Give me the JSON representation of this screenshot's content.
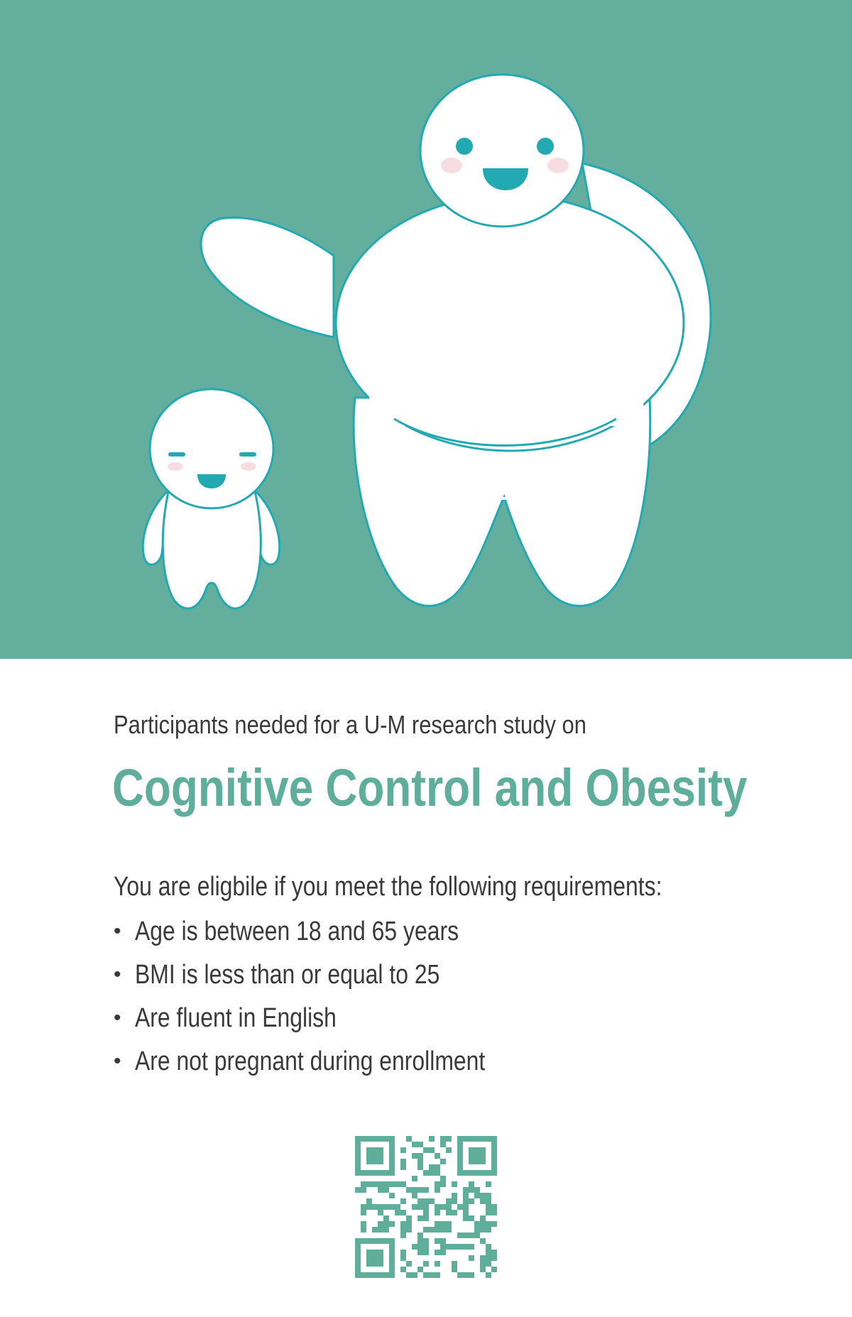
{
  "hero": {
    "background_color": "#64ae9e",
    "illustration": [
      "tall-mascot-waving",
      "small-mascot-smiling"
    ]
  },
  "intro_text": "Participants needed for a U-M research study on",
  "title": "Cognitive Control and Obesity",
  "title_color": "#5fae9c",
  "eligibility_heading": "You are eligbile if you meet the following requirements:",
  "requirements": [
    "Age is between 18 and 65 years",
    "BMI is less than or equal to 25",
    "Are fluent in English",
    "Are not pregnant during enrollment"
  ],
  "bullet_glyph": "•",
  "qr_code": {
    "icon": "qr-code-icon",
    "color": "#5fae9c"
  }
}
